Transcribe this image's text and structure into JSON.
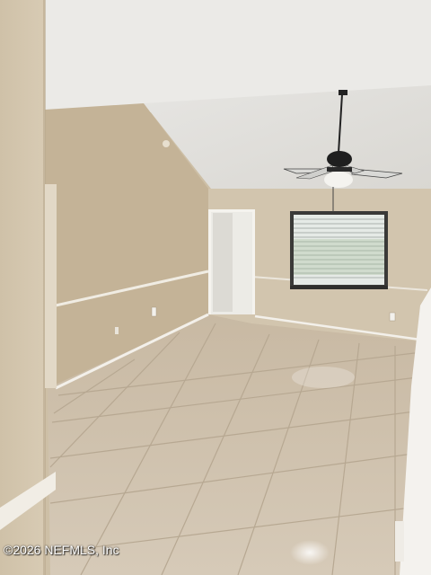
{
  "photo": {
    "subject": "Empty living room with vaulted ceiling, ceiling fan, window with blinds and tile floor",
    "watermark": "©2026 NEFMLS, Inc",
    "palette": {
      "wall": "#cdbfa6",
      "wall_shadow": "#bfae93",
      "ceiling": "#e9e8e4",
      "floor": "#c9bba6",
      "floor_grout": "#b8a893",
      "trim": "#f2efe8",
      "fan": "#2a2a2a",
      "window_light": "#e7ece9"
    }
  }
}
